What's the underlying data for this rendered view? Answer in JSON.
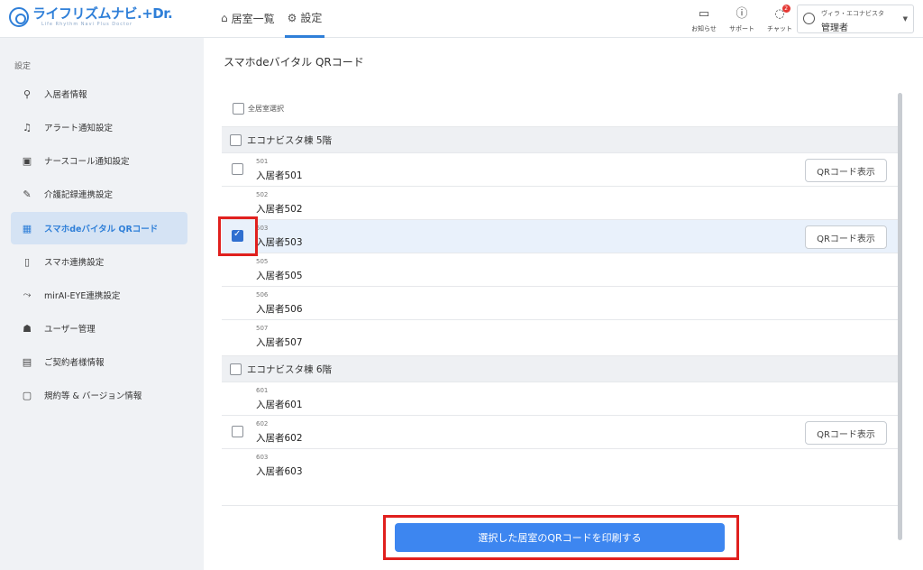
{
  "header": {
    "logo_text": "ライフリズムナビ.+Dr.",
    "logo_sub": "Life Rhythm Navi Plus Doctor",
    "nav": [
      {
        "label": "居室一覧",
        "icon": "home-icon",
        "active": false
      },
      {
        "label": "設定",
        "icon": "gear-icon",
        "active": true
      }
    ],
    "icons": [
      {
        "label": "お知らせ",
        "icon": "message-icon"
      },
      {
        "label": "サポート",
        "icon": "help-icon"
      },
      {
        "label": "チャット",
        "icon": "chat-icon",
        "badge": "2"
      }
    ],
    "user": {
      "org": "ヴィラ・エコナビスタ",
      "role": "管理者"
    }
  },
  "sidebar": {
    "title": "設定",
    "items": [
      {
        "label": "入居者情報",
        "icon": "person-gear-icon"
      },
      {
        "label": "アラート通知設定",
        "icon": "bell-icon"
      },
      {
        "label": "ナースコール通知設定",
        "icon": "nurse-call-icon"
      },
      {
        "label": "介護記録連携設定",
        "icon": "edit-icon"
      },
      {
        "label": "スマホdeバイタル QRコード",
        "icon": "qr-icon",
        "active": true
      },
      {
        "label": "スマホ連携設定",
        "icon": "smartphone-icon"
      },
      {
        "label": "mirAI-EYE連携設定",
        "icon": "sensor-icon"
      },
      {
        "label": "ユーザー管理",
        "icon": "users-icon"
      },
      {
        "label": "ご契約者様情報",
        "icon": "archive-icon"
      },
      {
        "label": "規約等 & バージョン情報",
        "icon": "document-icon"
      }
    ]
  },
  "main": {
    "title": "スマホdeバイタル QRコード",
    "all_select": "全居室選択",
    "qr_button": "QRコード表示",
    "print_button": "選択した居室のQRコードを印刷する",
    "buildings": [
      {
        "name": "エコナビスタ棟 5階",
        "rooms": [
          {
            "no": "501",
            "name": "入居者501",
            "checkbox": true,
            "checked": false,
            "qr": true
          },
          {
            "no": "502",
            "name": "入居者502",
            "checkbox": false,
            "checked": false,
            "qr": false
          },
          {
            "no": "503",
            "name": "入居者503",
            "checkbox": true,
            "checked": true,
            "qr": true
          },
          {
            "no": "505",
            "name": "入居者505",
            "checkbox": false,
            "checked": false,
            "qr": false
          },
          {
            "no": "506",
            "name": "入居者506",
            "checkbox": false,
            "checked": false,
            "qr": false
          },
          {
            "no": "507",
            "name": "入居者507",
            "checkbox": false,
            "checked": false,
            "qr": false
          }
        ]
      },
      {
        "name": "エコナビスタ棟 6階",
        "rooms": [
          {
            "no": "601",
            "name": "入居者601",
            "checkbox": false,
            "checked": false,
            "qr": false
          },
          {
            "no": "602",
            "name": "入居者602",
            "checkbox": true,
            "checked": false,
            "qr": true
          },
          {
            "no": "603",
            "name": "入居者603",
            "checkbox": false,
            "checked": false,
            "qr": false
          }
        ]
      }
    ]
  },
  "colors": {
    "accent": "#2f7fd8",
    "print_button": "#3d86f0",
    "highlight": "#e0201e"
  }
}
